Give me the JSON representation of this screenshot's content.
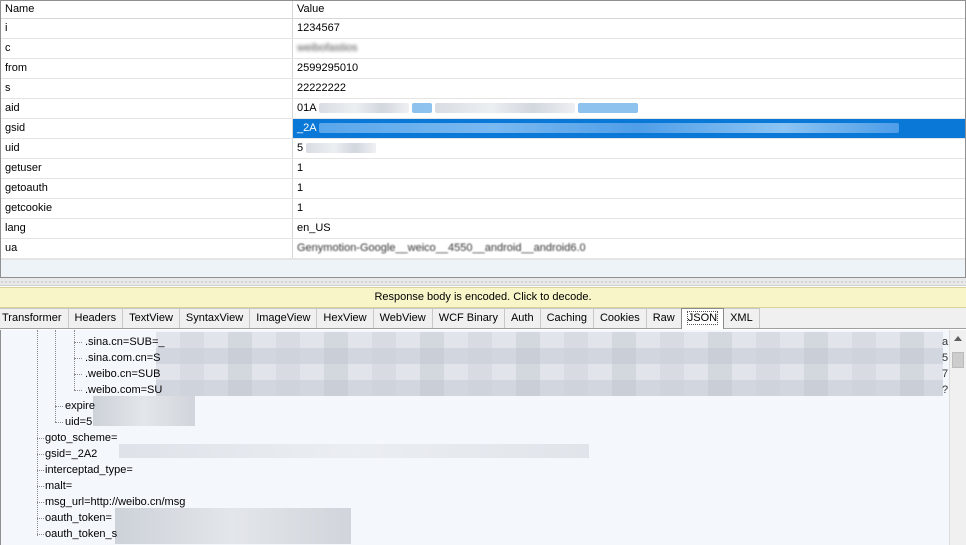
{
  "grid": {
    "header": {
      "name": "Name",
      "value": "Value"
    },
    "rows": [
      {
        "name": "i",
        "value": "1234567"
      },
      {
        "name": "c",
        "value": "weibofastios"
      },
      {
        "name": "from",
        "value": "2599295010"
      },
      {
        "name": "s",
        "value": "22222222"
      },
      {
        "name": "aid",
        "value": "01A"
      },
      {
        "name": "gsid",
        "value": "_2A"
      },
      {
        "name": "uid",
        "value": "5"
      },
      {
        "name": "getuser",
        "value": "1"
      },
      {
        "name": "getoauth",
        "value": "1"
      },
      {
        "name": "getcookie",
        "value": "1"
      },
      {
        "name": "lang",
        "value": "en_US"
      },
      {
        "name": "ua",
        "value": "Genymotion-Google__weico__4550__android__android6.0"
      }
    ],
    "selected_row": "gsid"
  },
  "notice": "Response body is encoded. Click to decode.",
  "tabs": [
    "Transformer",
    "Headers",
    "TextView",
    "SyntaxView",
    "ImageView",
    "HexView",
    "WebView",
    "WCF Binary",
    "Auth",
    "Caching",
    "Cookies",
    "Raw",
    "JSON",
    "XML"
  ],
  "active_tab": "JSON",
  "tree": {
    "nodes": [
      ".sina.cn=SUB=_",
      ".sina.com.cn=S",
      ".weibo.cn=SUB",
      ".weibo.com=SU",
      "expire",
      "uid=5",
      "goto_scheme=",
      "gsid=_2A2",
      "interceptad_type=",
      "malt=",
      "msg_url=http://weibo.cn/msg",
      "oauth_token=",
      "oauth_token_s"
    ],
    "right_edge_chars": [
      "a",
      "5",
      "7",
      "?"
    ]
  },
  "colors": {
    "selection": "#0a78d7",
    "notice_bg": "#f8f6c9",
    "tree_bg": "#f4f7fc"
  },
  "icons": {
    "scroll_up": "triangle-up-icon"
  }
}
